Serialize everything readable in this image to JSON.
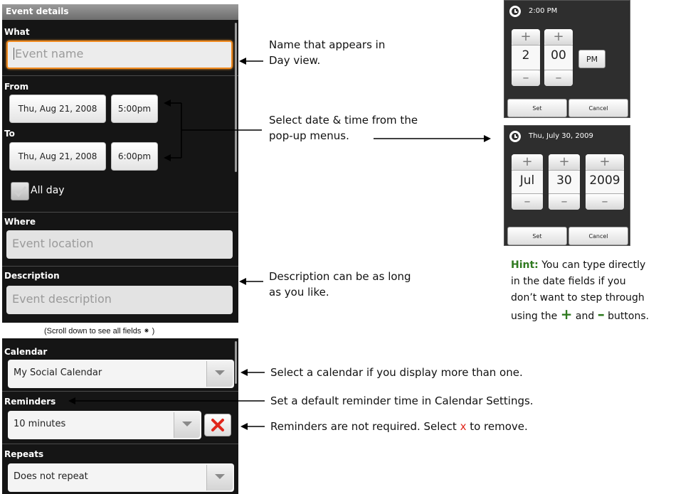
{
  "event": {
    "header": "Event details",
    "what_label": "What",
    "event_name_placeholder": "Event name",
    "from_label": "From",
    "from_date": "Thu, Aug 21, 2008",
    "from_time": "5:00pm",
    "to_label": "To",
    "to_date": "Thu, Aug 21, 2008",
    "to_time": "6:00pm",
    "all_day_label": "All day",
    "where_label": "Where",
    "location_placeholder": "Event location",
    "description_label": "Description",
    "description_placeholder": "Event description"
  },
  "scroll_caption": "(Scroll down to see all fields ⁕ )",
  "settings": {
    "calendar_label": "Calendar",
    "calendar_value": "My Social Calendar",
    "reminders_label": "Reminders",
    "reminders_value": "10 minutes",
    "repeats_label": "Repeats",
    "repeats_value": "Does not repeat"
  },
  "time_picker": {
    "title": "2:00 PM",
    "hour": "2",
    "minute": "00",
    "ampm": "PM",
    "set_label": "Set",
    "cancel_label": "Cancel"
  },
  "date_picker": {
    "title": "Thu, July 30, 2009",
    "month": "Jul",
    "day": "30",
    "year": "2009",
    "set_label": "Set",
    "cancel_label": "Cancel"
  },
  "annotations": {
    "name_line1": "Name that appears in",
    "name_line2": "Day view.",
    "select_line1": "Select date & time from the",
    "select_line2": "pop-up menus.",
    "desc_line1": "Description can be as long",
    "desc_line2": "as you like.",
    "hint_bold": "Hint:",
    "hint_line1": " You can type directly",
    "hint_line2": "in the date fields if you",
    "hint_line3": "don’t want to step through",
    "hint_line4a": "using the ",
    "hint_plus": "+",
    "hint_and": " and ",
    "hint_minus": "–",
    "hint_line4b": " buttons.",
    "calendar_note": "Select a calendar if you display more than one.",
    "reminder_note": "Set a default reminder time in Calendar Settings.",
    "remove_note_a": "Reminders are not required. Select ",
    "remove_note_x": "x",
    "remove_note_b": " to remove."
  },
  "colors": {
    "focus_orange": "#f08a1e",
    "hint_green": "#2f7a1f",
    "remove_red": "#e0261b"
  },
  "icons": [
    "clock-icon",
    "checkmark-icon",
    "close-icon",
    "dropdown-arrow-icon",
    "arrow-left-icon",
    "arrow-right-icon"
  ]
}
